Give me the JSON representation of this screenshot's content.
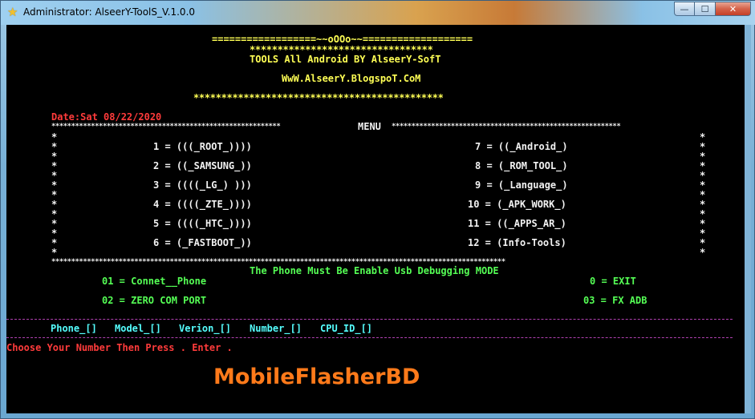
{
  "window": {
    "title": "Administrator: AlseerY-ToolS_V.1.0.0",
    "buttons": {
      "minimize": "—",
      "maximize": "☐",
      "close": "✕"
    }
  },
  "header": {
    "line1": "==================~~oOOo~~===================",
    "line2": "*********************************",
    "line3": "TOOLS All Android BY AlseerY-SofT",
    "line4": "WwW.AlseerY.BlogspoT.CoM",
    "line5": "*********************************************"
  },
  "date": "Date:Sat 08/22/2020",
  "menu": {
    "title": "MENU",
    "left_items": [
      "1 = (((_ROOT_))))",
      "2 = ((_SAMSUNG_))",
      "3 = ((((_LG_) )))",
      "4 = ((((_ZTE_))))",
      "5 = ((((_HTC_))))",
      "6 = (_FASTBOOT_))"
    ],
    "right_items": [
      "7 = ((_Android_)",
      "8 = (_ROM_TOOL_)",
      "9 = (_Language_)",
      "10 = (_APK_WORK_)",
      "11 = ((_APPS_AR_)",
      "12 = (Info-Tools)"
    ]
  },
  "notice": "The Phone Must Be Enable Usb Debugging MODE",
  "options": {
    "connect": "01 = Connet__Phone",
    "zero_com": "02 = ZERO COM PORT",
    "exit": "0 = EXIT",
    "fix_adb": "03 = FX ADB"
  },
  "info_fields": [
    "Phone_[]",
    "Model_[]",
    "Verion_[]",
    "Number_[]",
    "CPU_ID_[]"
  ],
  "prompt": "Choose Your Number Then Press . Enter .",
  "watermark": "MobileFlasherBD",
  "colors": {
    "yellow": "#ffff55",
    "red": "#ff3b3b",
    "green": "#55ff55",
    "cyan": "#55ffff",
    "watermark": "#ff7a1a"
  }
}
